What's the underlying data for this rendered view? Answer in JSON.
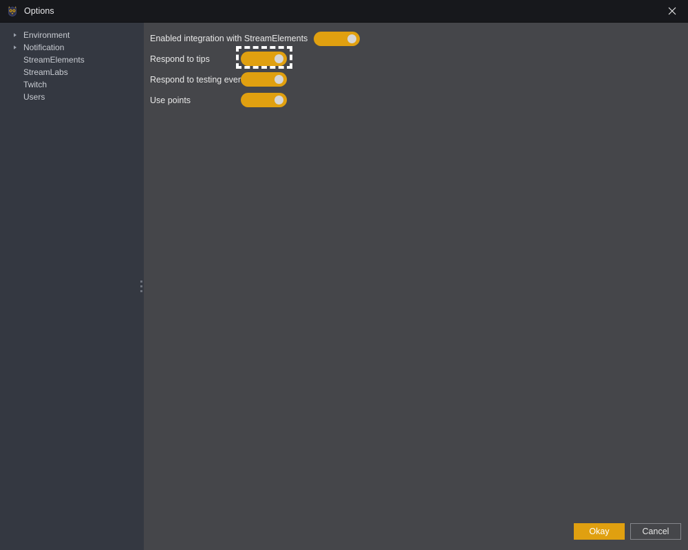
{
  "window": {
    "title": "Options",
    "app_icon": "owl-mascot-icon",
    "close_icon": "close-icon"
  },
  "sidebar": {
    "items": [
      {
        "label": "Environment",
        "expandable": true,
        "icon": "chevron-right-icon"
      },
      {
        "label": "Notification",
        "expandable": true,
        "icon": "chevron-right-icon"
      },
      {
        "label": "StreamElements",
        "expandable": false,
        "icon": ""
      },
      {
        "label": "StreamLabs",
        "expandable": false,
        "icon": ""
      },
      {
        "label": "Twitch",
        "expandable": false,
        "icon": ""
      },
      {
        "label": "Users",
        "expandable": false,
        "icon": ""
      }
    ],
    "splitter_icon": "splitter-grip-icon"
  },
  "main": {
    "options": [
      {
        "label": "Enabled integration with StreamElements",
        "state": "on",
        "focused": false
      },
      {
        "label": "Respond to tips",
        "state": "on",
        "focused": true
      },
      {
        "label": "Respond to testing events",
        "state": "on",
        "focused": false
      },
      {
        "label": "Use points",
        "state": "on",
        "focused": false
      }
    ]
  },
  "footer": {
    "okay_label": "Okay",
    "cancel_label": "Cancel"
  },
  "colors": {
    "accent": "#e0a010",
    "titlebar_bg": "#17181c",
    "sidebar_bg": "#343841",
    "main_bg": "#45464a",
    "focus_outline": "#ffffff",
    "toggle_knob": "#d6d6d6"
  }
}
